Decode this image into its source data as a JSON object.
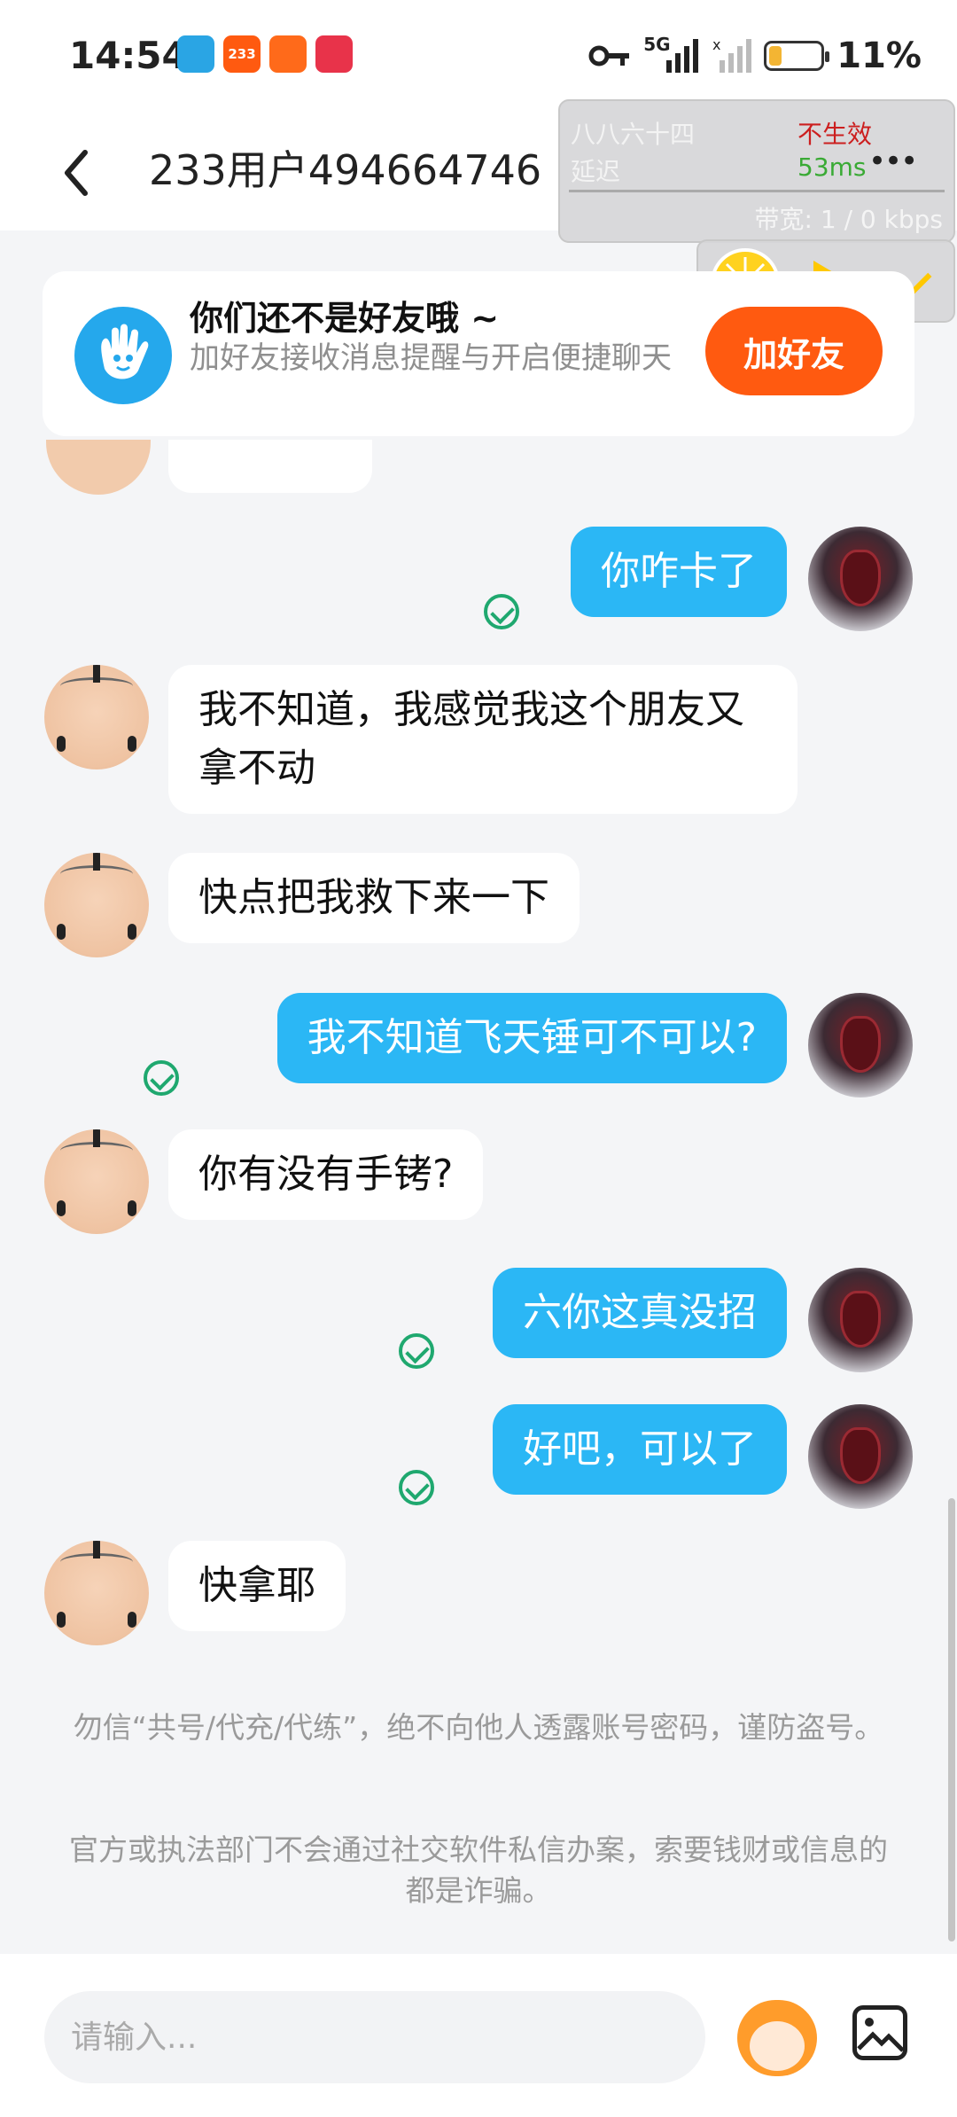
{
  "status_bar": {
    "time": "14:54",
    "app_icons": [
      {
        "name": "app-store-icon",
        "label": "",
        "color": "#2aa5e4"
      },
      {
        "name": "app-233-icon",
        "label": "233",
        "color": "#ff5a10"
      },
      {
        "name": "app-orange-icon",
        "label": "",
        "color": "#ff6a1a"
      },
      {
        "name": "app-red-icon",
        "label": "",
        "color": "#e8334a"
      }
    ],
    "network": "5G",
    "battery": "11%"
  },
  "header": {
    "title": "233用户494664746"
  },
  "overlay": {
    "name": "八八六十四",
    "status": "不生效",
    "latency_label": "延迟",
    "latency_value": "53ms",
    "bandwidth": "带宽: 1 / 0 kbps",
    "menu": "•••"
  },
  "friend_card": {
    "title": "你们还不是好友哦 ~",
    "subtitle": "加好友接收消息提醒与开启便捷聊天",
    "add_button": "加好友"
  },
  "messages": [
    {
      "from": "me",
      "text": "你咋卡了"
    },
    {
      "from": "them",
      "text": "我不知道，我感觉我这个朋友又拿不动"
    },
    {
      "from": "them",
      "text": "快点把我救下来一下"
    },
    {
      "from": "me",
      "text": "我不知道飞天锤可不可以?"
    },
    {
      "from": "them",
      "text": "你有没有手铐?"
    },
    {
      "from": "me",
      "text": "六你这真没招"
    },
    {
      "from": "me",
      "text": "好吧，可以了"
    },
    {
      "from": "them",
      "text": "快拿耶"
    }
  ],
  "notices": [
    "勿信“共号/代充/代练”，绝不向他人透露账号密码，谨防盗号。",
    "官方或执法部门不会通过社交软件私信办案，索要钱财或信息的都是诈骗。"
  ],
  "input_bar": {
    "placeholder": "请输入..."
  },
  "colors": {
    "accent": "#2bb7f5",
    "add_button": "#ff5a10",
    "check": "#1fa86f",
    "overlay_status": "#cc1f1f",
    "overlay_latency": "#3aaa35"
  }
}
